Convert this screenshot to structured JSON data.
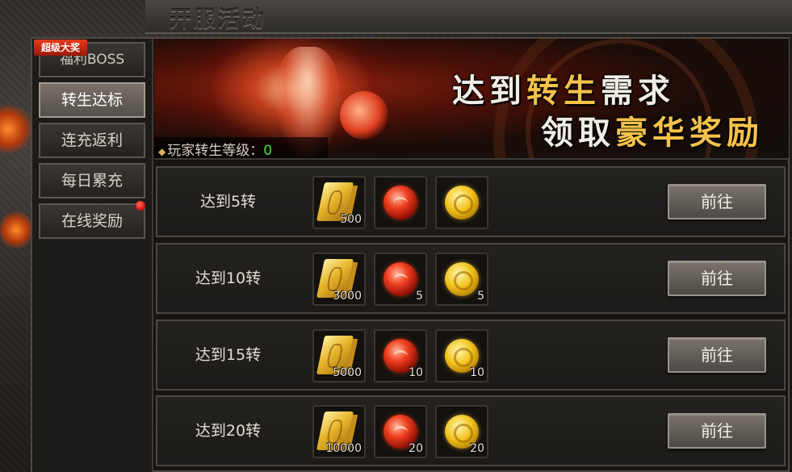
{
  "header": {
    "title": "开服活动"
  },
  "sidebar": {
    "super_badge": "超级大奖",
    "tabs": [
      {
        "label": "福利BOSS"
      },
      {
        "label": "转生达标"
      },
      {
        "label": "连充返利"
      },
      {
        "label": "每日累充"
      },
      {
        "label": "在线奖励"
      }
    ],
    "active_tab": 1
  },
  "banner": {
    "slogan_line1_a": "达到",
    "slogan_line1_b": "转生",
    "slogan_line1_c": "需求",
    "slogan_line2_a": "领取",
    "slogan_line2_b": "豪华奖励",
    "level_label": "玩家转生等级：",
    "level_value": "0"
  },
  "rows": [
    {
      "label": "达到5转",
      "rewards": [
        {
          "icon": "gold-ticket-icon",
          "count": "500"
        },
        {
          "icon": "red-orb-icon",
          "count": ""
        },
        {
          "icon": "gold-coin-icon",
          "count": ""
        }
      ],
      "button": "前往"
    },
    {
      "label": "达到10转",
      "rewards": [
        {
          "icon": "gold-ticket-icon",
          "count": "3000"
        },
        {
          "icon": "red-orb-icon",
          "count": "5"
        },
        {
          "icon": "gold-coin-icon",
          "count": "5"
        }
      ],
      "button": "前往"
    },
    {
      "label": "达到15转",
      "rewards": [
        {
          "icon": "gold-ticket-icon",
          "count": "5000"
        },
        {
          "icon": "red-orb-icon",
          "count": "10"
        },
        {
          "icon": "gold-coin-icon",
          "count": "10"
        }
      ],
      "button": "前往"
    },
    {
      "label": "达到20转",
      "rewards": [
        {
          "icon": "gold-ticket-icon",
          "count": "10000"
        },
        {
          "icon": "red-orb-icon",
          "count": "20"
        },
        {
          "icon": "gold-coin-icon",
          "count": "20"
        }
      ],
      "button": "前往"
    }
  ],
  "colors": {
    "level_value": "#45e045",
    "highlight": "#f5c24a",
    "badge": "#d42a12"
  }
}
